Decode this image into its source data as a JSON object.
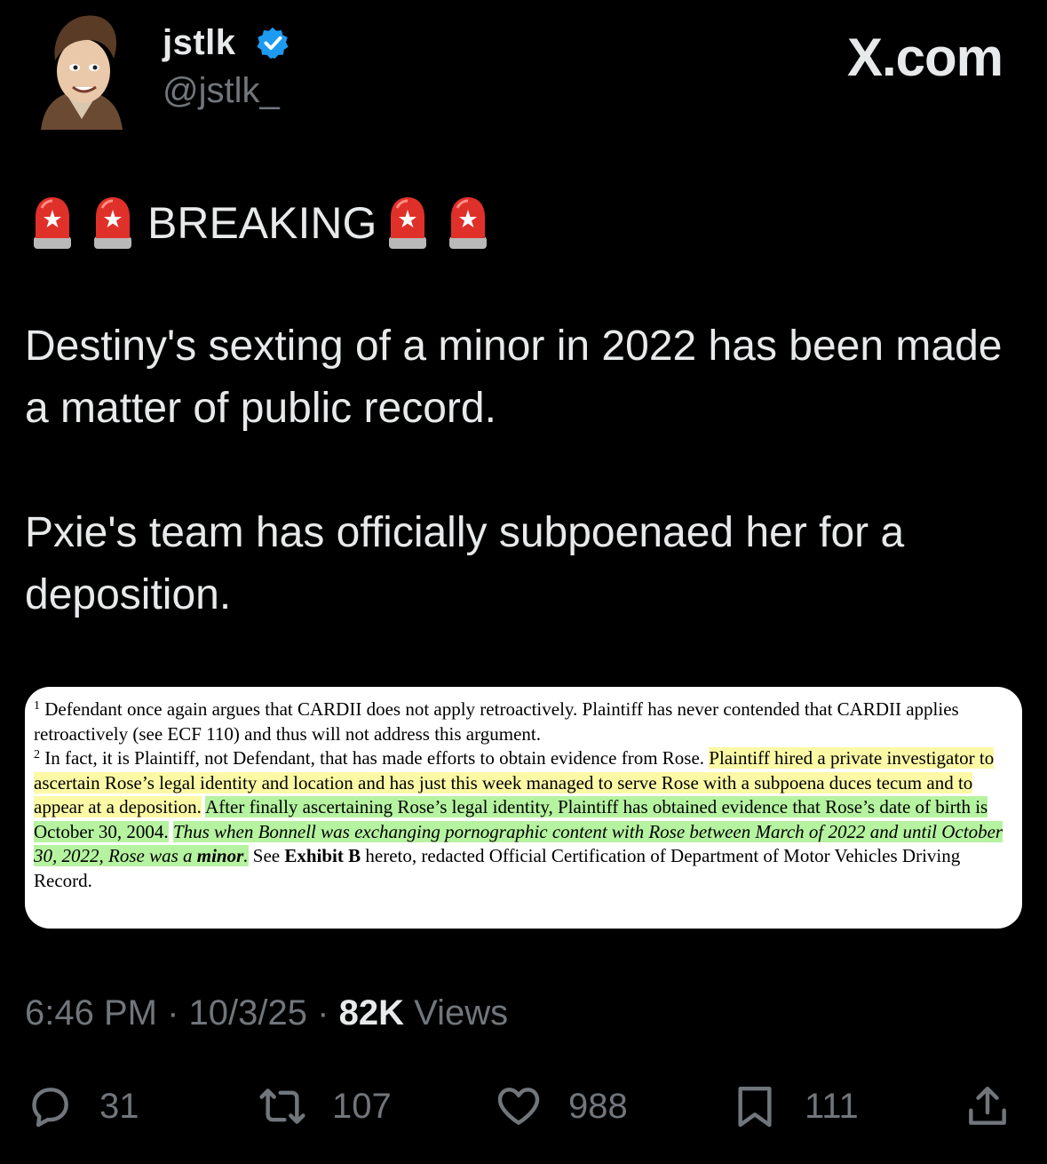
{
  "user": {
    "display_name": "jstlk",
    "handle": "@jstlk_"
  },
  "brand": "X.com",
  "post": {
    "breaking": "BREAKING",
    "paragraph_1": "Destiny's sexting of a minor in 2022 has been made a matter of public record.",
    "paragraph_2": "Pxie's team has officially subpoenaed her for a deposition."
  },
  "document": {
    "fn1_num": "1",
    "fn1_text": "Defendant once again argues that CARDII does not apply retroactively. Plaintiff has never contended that CARDII applies retroactively (see ECF 110) and thus will not address this argument.",
    "fn2_num": "2",
    "fn2_text_a": "In fact, it is Plaintiff, not Defendant, that has made efforts to obtain evidence from Rose. ",
    "fn2_highlight_yellow": "Plaintiff hired a private investigator to ascertain Rose’s legal identity and location and has just this week managed to serve Rose with a subpoena duces tecum and to appear at a deposition.",
    "fn2_highlight_green": "After finally ascertaining Rose’s legal identity, Plaintiff has obtained evidence that Rose’s date of birth is October 30, 2004.",
    "fn2_highlight_green_italic": "Thus when Bonnell was exchanging pornographic content with Rose between March of 2022 and until October 30, 2022, Rose was a ",
    "fn2_minor": "minor",
    "fn2_period": ".",
    "fn2_see": " See ",
    "fn2_exhibit": "Exhibit B",
    "fn2_tail": " hereto, redacted Official Certification of Department of Motor Vehicles Driving Record."
  },
  "meta": {
    "time": "6:46 PM",
    "date": "10/3/25",
    "views_count": "82K",
    "views_label": "Views",
    "separator": "·"
  },
  "actions": {
    "replies": "31",
    "reposts": "107",
    "likes": "988",
    "bookmarks": "111"
  },
  "colors": {
    "background": "#000000",
    "text": "#e7e9ea",
    "muted": "#71767b",
    "verified": "#1d9bf0",
    "highlight_yellow": "#fbf9a5",
    "highlight_green": "#b6f3a0",
    "siren": "#e0302a"
  },
  "icons": [
    "cartoon-avatar",
    "verified-badge-icon",
    "siren-emoji",
    "reply-icon",
    "repost-icon",
    "like-icon",
    "bookmark-icon",
    "share-icon"
  ]
}
